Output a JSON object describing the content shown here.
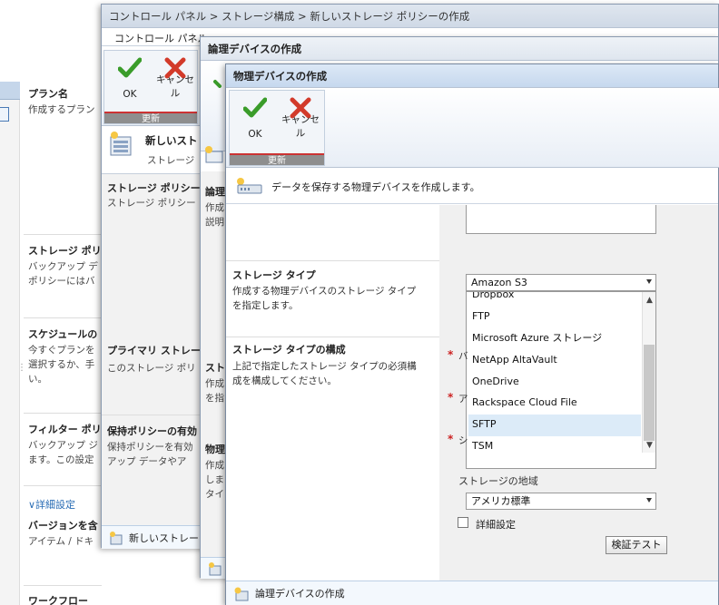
{
  "base": {
    "sections": [
      {
        "title": "プラン名",
        "desc": "作成するプラン"
      },
      {
        "title": "ストレージ ポリ",
        "desc": "バックアップ デ\nポリシーにはバ"
      },
      {
        "title": "スケジュールの",
        "desc": "今すぐプランを\n選択するか、手\nい。"
      },
      {
        "title": "フィルター ポリ",
        "desc": "バックアップ ジ\nます。この設定"
      },
      {
        "title": "バージョンを含",
        "desc": "アイテム / ドキ"
      },
      {
        "title": "ワークフロー",
        "desc": ""
      }
    ],
    "advanced_link": "∨詳細設定"
  },
  "dialog1": {
    "title": "コントロール パネル > ストレージ構成 > 新しいストレージ ポリシーの作成",
    "tab": "コントロール パネル",
    "ok": "OK",
    "cancel": "キャンセル",
    "group": "更新",
    "header_title": "新しいスト",
    "header_desc": "ストレージ",
    "sections": [
      {
        "title": "ストレージ ポリシー",
        "desc": "ストレージ ポリシー"
      },
      {
        "title": "プライマリ ストレー",
        "desc": "このストレージ ポリ"
      },
      {
        "title": "保持ポリシーの有効",
        "desc": "保持ポリシーを有効\nアップ データやア"
      }
    ],
    "footer": "新しいストレー"
  },
  "dialog2": {
    "title": "論理デバイスの作成",
    "sections": [
      {
        "title": "論理",
        "desc": "作成\n説明"
      },
      {
        "title": "スト",
        "desc": "作成\nを指"
      },
      {
        "title": "物理",
        "desc": "作成\nしま\nタイ"
      }
    ]
  },
  "dialog3": {
    "title": "物理デバイスの作成",
    "ok": "OK",
    "cancel": "キャンセル",
    "group": "更新",
    "info": "データを保存する物理デバイスを作成します。",
    "storage_type": {
      "title": "ストレージ タイプ",
      "desc": "作成する物理デバイスのストレージ タイプ\nを指定します。",
      "selected": "Amazon S3",
      "options": [
        "Dropbox",
        "FTP",
        "Microsoft Azure ストレージ",
        "NetApp AltaVault",
        "OneDrive",
        "Rackspace Cloud File",
        "SFTP",
        "TSM"
      ],
      "highlighted": "SFTP"
    },
    "config": {
      "title": "ストレージ タイプの構成",
      "desc": "上記で指定したストレージ タイプの必須構\n成を構成してください。",
      "partial_labels": [
        "バ",
        "ア",
        "シ"
      ]
    },
    "region_label": "ストレージの地域",
    "region_value": "アメリカ標準",
    "advanced_checkbox": "詳細設定",
    "test_button": "検証テスト",
    "footer": "論理デバイスの作成"
  }
}
